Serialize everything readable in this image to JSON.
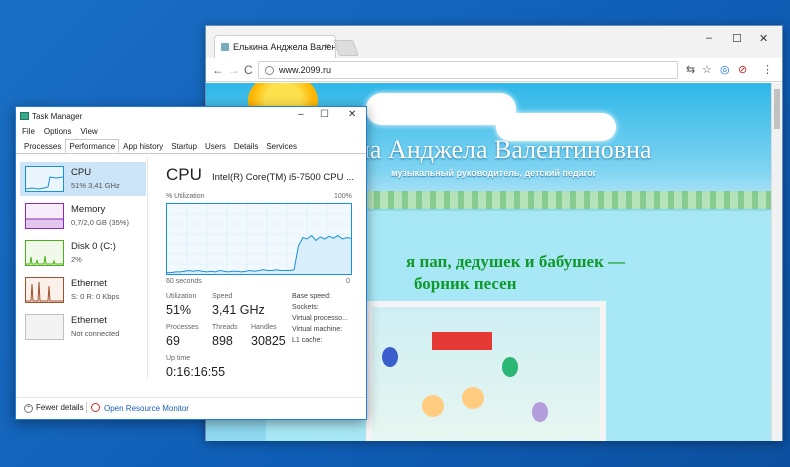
{
  "browser": {
    "tab_title": "Елькина Анджела Вален",
    "tab_close": "×",
    "url": "www.2099.ru",
    "window_minimize": "–",
    "window_maximize": "☐",
    "window_close": "✕",
    "nav_back": "←",
    "nav_forward": "→",
    "nav_reload": "C",
    "ext_translate": "⇆",
    "ext_star": "☆",
    "ext_sync": "◎",
    "ext_block": "⊘",
    "ext_menu": "⋮"
  },
  "site": {
    "title": "на Анджела Валентиновна",
    "subtitle": "музыкальный руководитель, детский педагог",
    "article_title_1": "я пап, дедушек и бабушек —",
    "article_title_2": "борник песен"
  },
  "task_manager": {
    "title": "Task Manager",
    "minimize": "–",
    "maximize": "☐",
    "close": "✕",
    "menu": [
      "File",
      "Options",
      "View"
    ],
    "tabs": [
      "Processes",
      "Performance",
      "App history",
      "Startup",
      "Users",
      "Details",
      "Services"
    ],
    "resources": [
      {
        "name": "CPU",
        "value": "51% 3,41 GHz",
        "color": "#1a8fdb"
      },
      {
        "name": "Memory",
        "value": "0,7/2,0 GB (35%)",
        "color": "#8b2ab3"
      },
      {
        "name": "Disk 0 (C:)",
        "value": "2%",
        "color": "#4caf1a"
      },
      {
        "name": "Ethernet",
        "value": "S: 0 R: 0 Kbps",
        "color": "#a0522d"
      },
      {
        "name": "Ethernet",
        "value": "Not connected",
        "color": "#a0a0a0"
      }
    ],
    "cpu": {
      "heading": "CPU",
      "model": "Intel(R) Core(TM) i5-7500 CPU ...",
      "util_label": "% Utilization",
      "max_label": "100%",
      "time_label": "60 seconds",
      "min_label": "0",
      "graph_utilization": [
        2,
        2,
        3,
        3,
        4,
        5,
        4,
        5,
        4,
        3,
        4,
        3,
        5,
        4,
        3,
        4,
        4,
        3,
        4,
        5,
        4,
        5,
        6,
        5,
        5,
        6,
        5,
        5,
        5,
        6,
        40,
        52,
        50,
        55,
        48,
        53,
        50,
        54,
        51,
        55,
        50,
        52,
        51
      ],
      "utilization_label": "Utilization",
      "utilization": "51%",
      "speed_label": "Speed",
      "speed": "3,41 GHz",
      "processes_label": "Processes",
      "processes": "69",
      "threads_label": "Threads",
      "threads": "898",
      "handles_label": "Handles",
      "handles": "30825",
      "uptime_label": "Up time",
      "uptime": "0:16:16:55",
      "specs": [
        "Base speed:",
        "Sockets:",
        "Virtual processo...",
        "Virtual machine:",
        "L1 cache:"
      ]
    },
    "fewer_details": "Fewer details",
    "fewer_icon": "⌃",
    "open_resource_monitor": "Open Resource Monitor"
  }
}
